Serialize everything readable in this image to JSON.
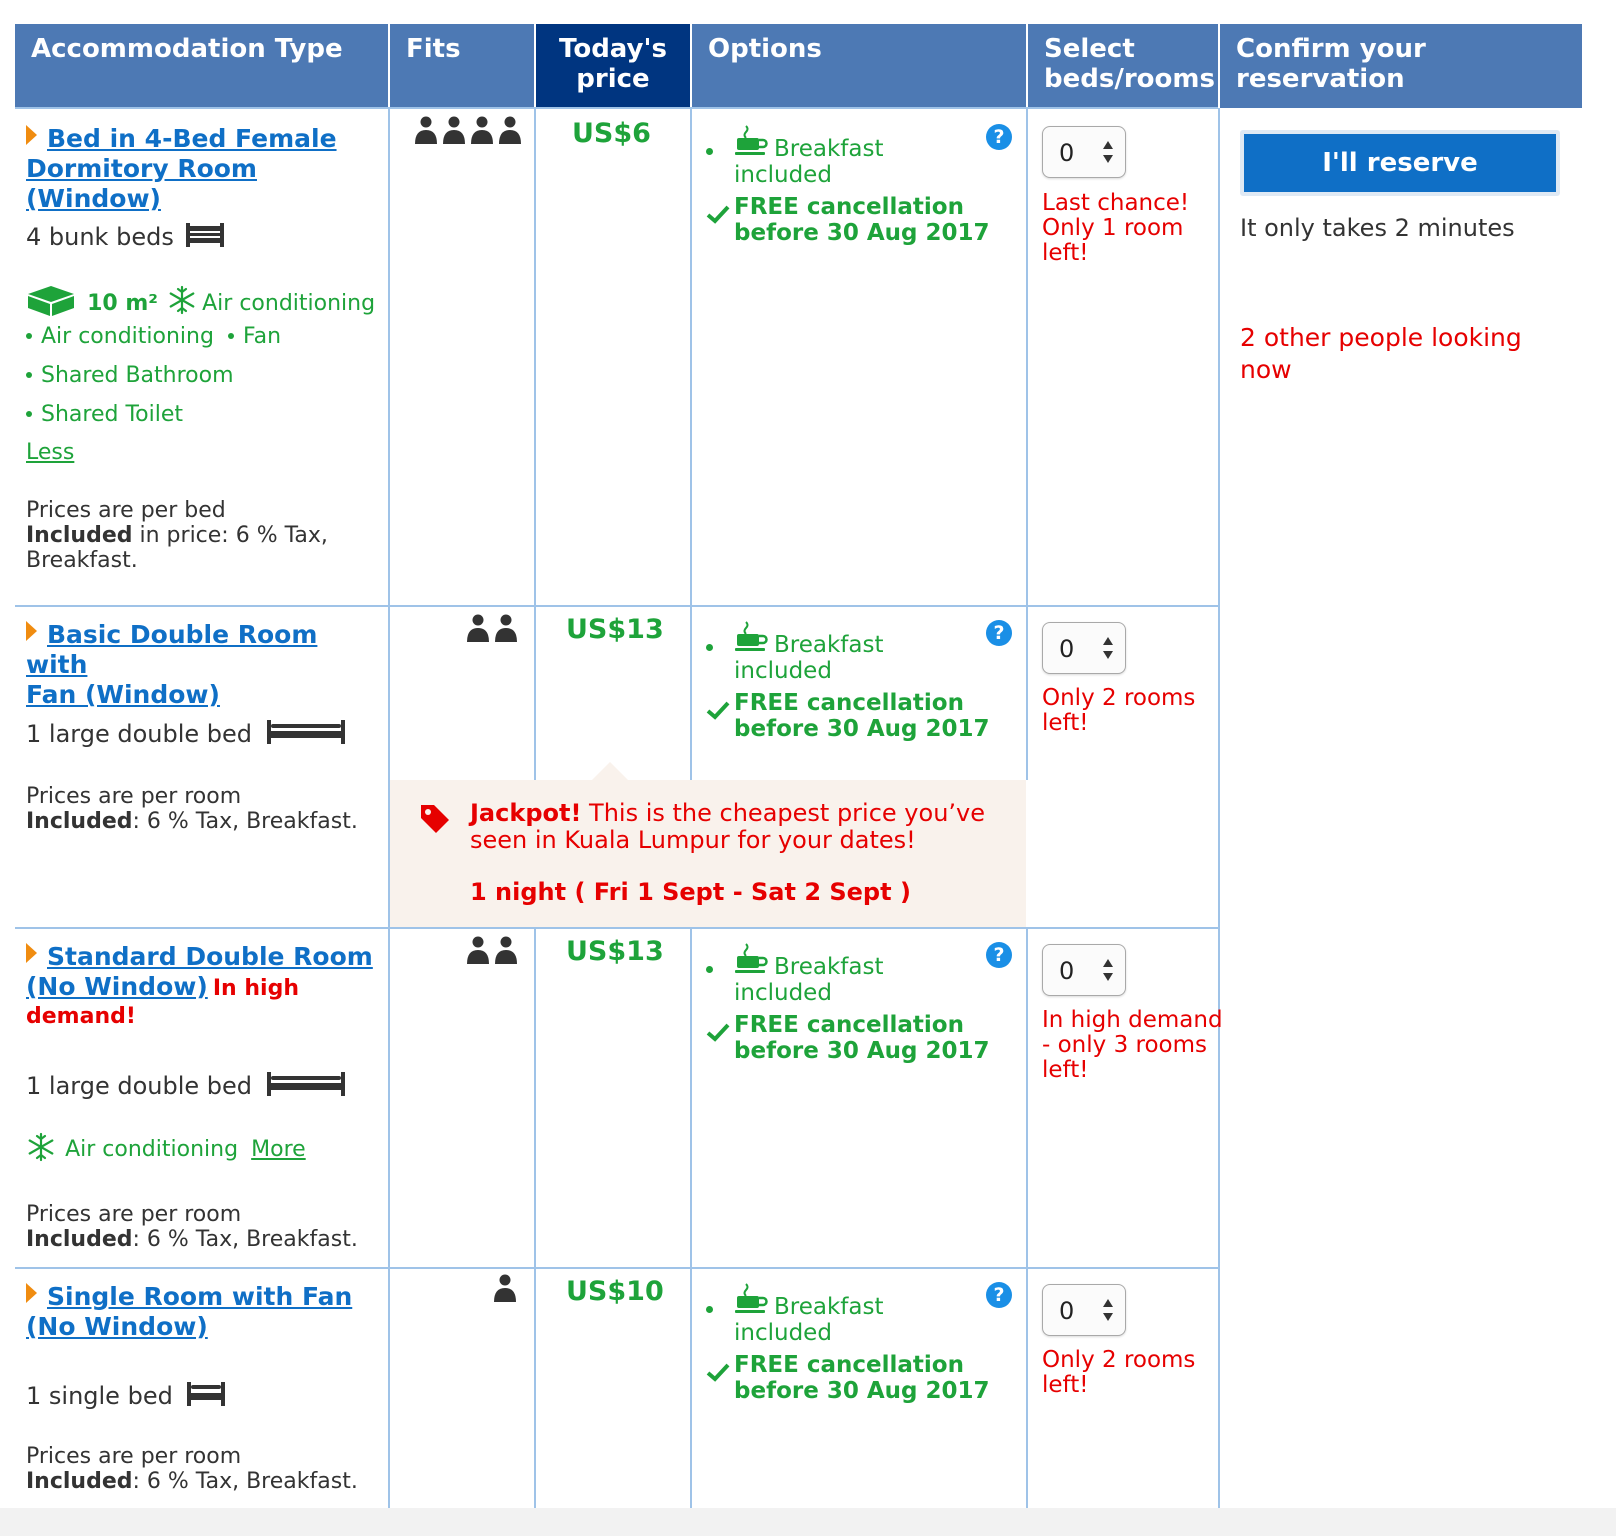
{
  "headers": {
    "type": "Accommodation Type",
    "fits": "Fits",
    "price": "Today's price",
    "options": "Options",
    "select": "Select beds/rooms",
    "confirm": "Confirm your reservation"
  },
  "option_labels": {
    "breakfast": "Breakfast included",
    "cancel_line1": "FREE cancellation",
    "cancel_line2": "before 30 Aug 2017",
    "help": "?"
  },
  "rooms": [
    {
      "name_line1": "Bed in 4-Bed Female",
      "name_line2": "Dormitory Room (Window)",
      "bed": "4 bunk beds",
      "size": "10 m²",
      "features": [
        "Air conditioning",
        "Air conditioning",
        "Fan",
        "Shared Bathroom",
        "Shared Toilet"
      ],
      "toggle": "Less",
      "prices_note": "Prices are per bed",
      "included_label": "Included",
      "included_text": " in price: 6 % Tax,",
      "included_text2": "Breakfast.",
      "fits": 4,
      "price": "US$6",
      "quantity": "0",
      "availability": [
        "Last chance!",
        "Only 1 room",
        "left!"
      ]
    },
    {
      "name_line1": "Basic Double Room with",
      "name_line2": "Fan (Window)",
      "bed": "1 large double bed",
      "prices_note": "Prices are per room",
      "included_label": "Included",
      "included_text": ": 6 % Tax, Breakfast.",
      "fits": 2,
      "price": "US$13",
      "quantity": "0",
      "availability": [
        "Only 2 rooms",
        "left!"
      ]
    },
    {
      "name_line1": "Standard Double Room",
      "name_line2": "(No Window)",
      "demand_a": "In high",
      "demand_b": "demand!",
      "bed": "1 large double bed",
      "feature": "Air conditioning",
      "toggle": "More",
      "prices_note": "Prices are per room",
      "included_label": "Included",
      "included_text": ": 6 % Tax, Breakfast.",
      "fits": 2,
      "price": "US$13",
      "quantity": "0",
      "availability": [
        "In high demand",
        "- only 3 rooms",
        "left!"
      ]
    },
    {
      "name_line1": "Single Room with Fan",
      "name_line2": "(No Window)",
      "bed": "1 single bed",
      "prices_note": "Prices are per room",
      "included_label": "Included",
      "included_text": ": 6 % Tax, Breakfast.",
      "fits": 1,
      "price": "US$10",
      "quantity": "0",
      "availability": [
        "Only 2 rooms",
        "left!"
      ]
    }
  ],
  "jackpot": {
    "title": "Jackpot!",
    "line1": " This is the cheapest price you’ve",
    "line2": "seen in Kuala Lumpur for your dates!",
    "dates": "1 night ( Fri 1 Sept - Sat 2 Sept )"
  },
  "confirm": {
    "button": "I'll reserve",
    "note": "It only takes 2 minutes",
    "watchers_line1": "2 other people looking",
    "watchers_line2": "now"
  },
  "colors": {
    "header": "#4d79b4",
    "header_highlight": "#003580",
    "link": "#0f6fc6",
    "green": "#1ea33a",
    "alert": "#e60000",
    "accent_triangle": "#f08c10",
    "jackpot_bg": "#f9f2ec"
  },
  "icons": [
    "person-icon",
    "bunk-bed-icon",
    "double-bed-icon",
    "single-bed-icon",
    "room-size-icon",
    "snowflake-icon",
    "coffee-cup-icon",
    "checkmark-icon",
    "help-icon",
    "price-tag-icon",
    "stepper-arrows-icon"
  ]
}
